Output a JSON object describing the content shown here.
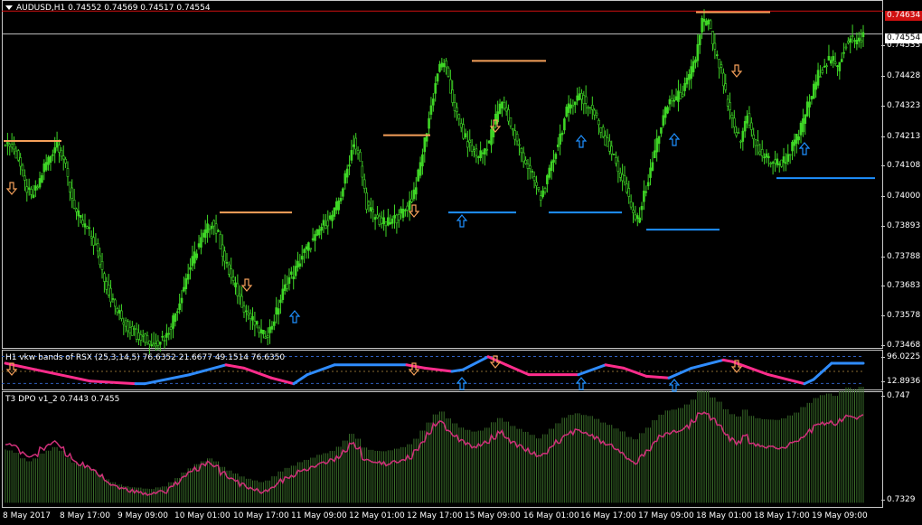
{
  "colors": {
    "background": "#000000",
    "candles": "#3fd626",
    "resistance": "#f5a05a",
    "support": "#1e90ff",
    "rsx_up": "#2f8cff",
    "rsx_down": "#ff2d8c",
    "dpo_line": "#d0307a",
    "dpo_hist": "#3a6e2a",
    "bid_line": "#c0c0c0",
    "ask_line": "#d01010"
  },
  "main_pane": {
    "symbol_label": "AUDUSD,H1  0.74552 0.74569 0.74517 0.74554",
    "price_ticks": [
      "0.74533",
      "0.74428",
      "0.74323",
      "0.74213",
      "0.74108",
      "0.74000",
      "0.73893",
      "0.73788",
      "0.73683",
      "0.73578",
      "0.73468"
    ],
    "current_price": "0.74554",
    "red_line_price": "0.74634",
    "arrow_up_icon": "arrow-up-icon",
    "arrow_down_icon": "arrow-down-icon"
  },
  "rsx_pane": {
    "label": "H1 vkw bands of RSX (25,3,14,5) 76.6352 21.6677 49.1514 76.6350",
    "ticks": [
      "96.0225",
      "12.8936"
    ]
  },
  "dpo_pane": {
    "label": "T3 DPO v1_2 0.7443 0.7455",
    "ticks": [
      "0.747",
      "0.7329"
    ]
  },
  "date_axis": [
    "8 May 2017",
    "8 May 17:00",
    "9 May 09:00",
    "10 May 01:00",
    "10 May 17:00",
    "11 May 09:00",
    "12 May 01:00",
    "12 May 17:00",
    "15 May 09:00",
    "16 May 01:00",
    "16 May 17:00",
    "17 May 09:00",
    "18 May 01:00",
    "18 May 17:00",
    "19 May 09:00"
  ],
  "chart_data": {
    "type": "candlestick",
    "symbol": "AUDUSD",
    "timeframe": "H1",
    "ohlc_last": [
      0.74552,
      0.74569,
      0.74517,
      0.74554
    ],
    "close_path": [
      0.7418,
      0.7416,
      0.7412,
      0.7403,
      0.7398,
      0.7402,
      0.7409,
      0.7413,
      0.7418,
      0.7412,
      0.7401,
      0.7393,
      0.7389,
      0.7386,
      0.7381,
      0.7373,
      0.7365,
      0.736,
      0.7356,
      0.7353,
      0.7351,
      0.735,
      0.7348,
      0.7347,
      0.7349,
      0.735,
      0.7356,
      0.7362,
      0.737,
      0.7376,
      0.7382,
      0.7386,
      0.739,
      0.7385,
      0.7376,
      0.737,
      0.7365,
      0.736,
      0.7356,
      0.7353,
      0.735,
      0.7352,
      0.7358,
      0.7365,
      0.737,
      0.7373,
      0.7378,
      0.7381,
      0.7384,
      0.7388,
      0.739,
      0.7393,
      0.7399,
      0.7408,
      0.7418,
      0.741,
      0.7396,
      0.7392,
      0.739,
      0.7389,
      0.739,
      0.7392,
      0.7394,
      0.7398,
      0.7406,
      0.7418,
      0.743,
      0.7442,
      0.7446,
      0.7435,
      0.7427,
      0.742,
      0.7416,
      0.7413,
      0.7414,
      0.7418,
      0.7426,
      0.7432,
      0.7426,
      0.7419,
      0.7414,
      0.7409,
      0.7404,
      0.7398,
      0.7404,
      0.7412,
      0.742,
      0.7428,
      0.7432,
      0.7434,
      0.7431,
      0.7429,
      0.7424,
      0.7418,
      0.7414,
      0.7408,
      0.7403,
      0.7394,
      0.739,
      0.7399,
      0.7407,
      0.7418,
      0.7426,
      0.7432,
      0.7433,
      0.7435,
      0.744,
      0.7447,
      0.746,
      0.7459,
      0.7449,
      0.7442,
      0.743,
      0.7422,
      0.7418,
      0.7428,
      0.7418,
      0.7414,
      0.7412,
      0.7411,
      0.741,
      0.7412,
      0.7416,
      0.742,
      0.7428,
      0.7434,
      0.7441,
      0.7445,
      0.7447,
      0.7443,
      0.745,
      0.7455,
      0.7452,
      0.7455
    ],
    "resistance_levels": [
      0.7418,
      0.7393,
      0.742,
      0.7446,
      0.7463
    ],
    "support_levels": [
      0.7393,
      0.7393,
      0.7387,
      0.7405
    ],
    "rsx_levels": [
      96.0225,
      12.8936
    ],
    "rsx_values": [
      [
        "8 May 2017",
        76.6
      ],
      [
        "9 May 09:00",
        12.9
      ],
      [
        "11 May 09:00",
        12.9
      ],
      [
        "12 May 01:00",
        96.0
      ],
      [
        "15 May 09:00",
        96.0
      ],
      [
        "16 May 01:00",
        12.9
      ],
      [
        "16 May 17:00",
        76.6
      ],
      [
        "17 May 09:00",
        12.9
      ],
      [
        "18 May 01:00",
        96.0
      ],
      [
        "18 May 17:00",
        12.9
      ],
      [
        "19 May 09:00",
        76.6
      ]
    ],
    "dpo_range": [
      0.7329,
      0.747
    ],
    "dpo_last": [
      0.7443,
      0.7455
    ]
  }
}
